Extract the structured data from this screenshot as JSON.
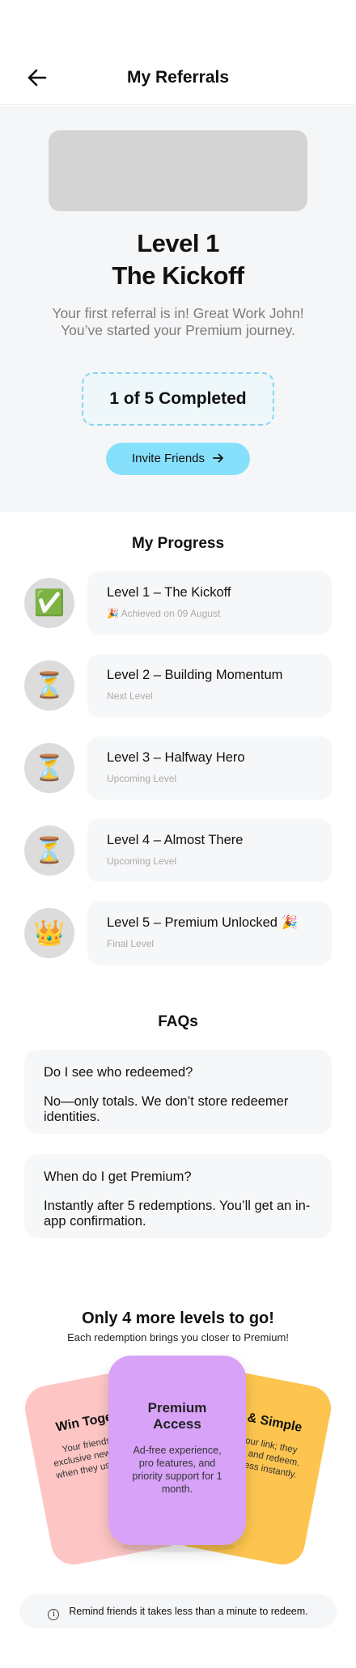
{
  "header": {
    "title": "My Referrals",
    "back_icon": "arrow-left-icon"
  },
  "hero": {
    "title_line1": "Level 1",
    "title_line2": "The Kickoff",
    "description": "Your first referral is in! Great Work John! You’ve started your Premium journey.",
    "progress_text": "1 of 5 Completed",
    "invite_label": "Invite Friends",
    "invite_icon": "arrow-right-icon"
  },
  "progress": {
    "title": "My Progress",
    "levels": [
      {
        "icon": "✅",
        "icon_name": "check-icon",
        "name": "Level 1 – The Kickoff",
        "sub": "🎉 Achieved on 09 August"
      },
      {
        "icon": "⏳",
        "icon_name": "hourglass-icon",
        "name": "Level 2 – Building Momentum",
        "sub": "Next Level"
      },
      {
        "icon": "⏳",
        "icon_name": "hourglass-icon",
        "name": "Level 3 – Halfway Hero",
        "sub": "Upcoming Level"
      },
      {
        "icon": "⏳",
        "icon_name": "hourglass-icon",
        "name": "Level 4 – Almost There",
        "sub": "Upcoming Level"
      },
      {
        "icon": "👑",
        "icon_name": "crown-icon",
        "name": "Level 5 – Premium Unlocked 🎉",
        "sub": "Final Level"
      }
    ]
  },
  "faqs": {
    "title": "FAQs",
    "items": [
      {
        "q": "Do I see who redeemed?",
        "a": "No—only totals. We don’t store redeemer identities."
      },
      {
        "q": "When do I get Premium?",
        "a": "Instantly after 5 redemptions. You’ll get an in-app confirmation."
      }
    ]
  },
  "cta": {
    "title": "Only 4 more levels to go!",
    "subtitle": "Each redemption brings you closer to Premium!",
    "cards": {
      "left": {
        "title": "Win Together",
        "desc": "Your friends get an exclusive new-user perk when they use your link."
      },
      "center": {
        "title": "Premium Access",
        "desc": "Ad-free experience, pro features, and priority support for 1 month."
      },
      "right": {
        "title": "Fast & Simple",
        "desc": "Share your link; they download and redeem. You progress instantly."
      }
    },
    "colors": {
      "left": "#fdc6c4",
      "center": "#d8a2f8",
      "right": "#fdc54f"
    }
  },
  "tip": {
    "icon_name": "info-icon",
    "text": "Remind friends it takes less than a minute to redeem."
  }
}
